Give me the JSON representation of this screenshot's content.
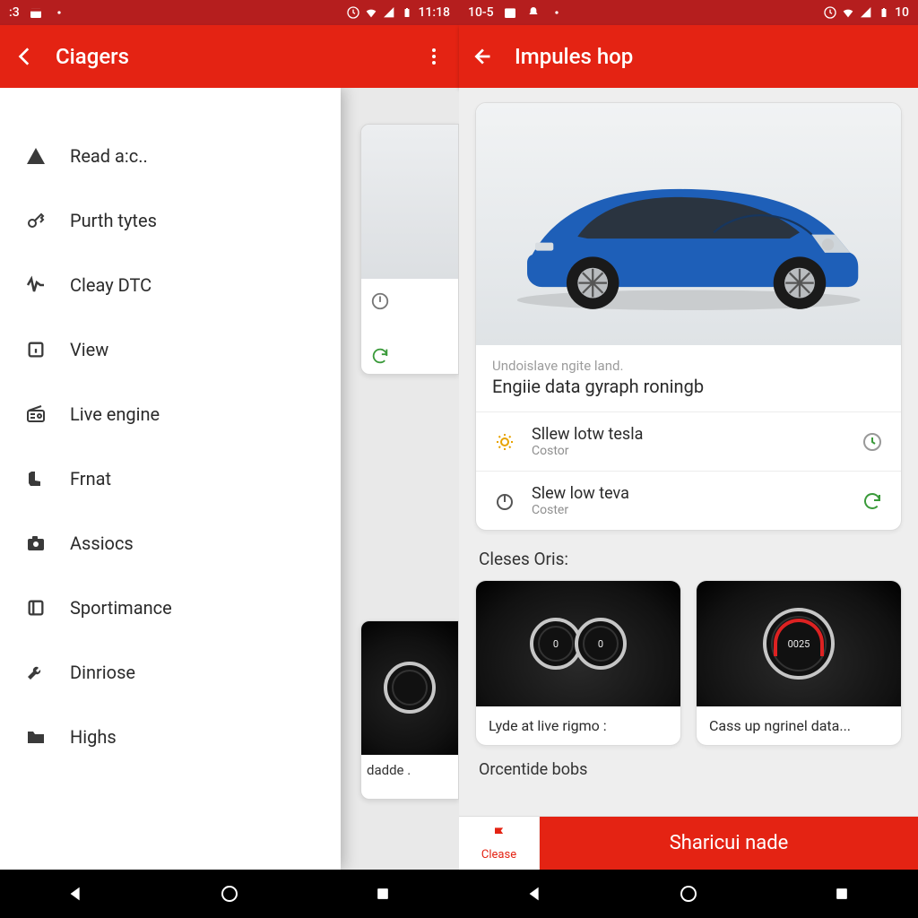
{
  "left": {
    "statusbar": {
      "time_label": ":3",
      "clock": "11:18"
    },
    "appbar": {
      "title": "Ciagers"
    },
    "drawer": {
      "items": [
        {
          "label": "Read a:c.."
        },
        {
          "label": "Purth tytes"
        },
        {
          "label": "Cleay DTC"
        },
        {
          "label": "View"
        },
        {
          "label": "Live engine"
        },
        {
          "label": "Frnat"
        },
        {
          "label": "Assiocs"
        },
        {
          "label": "Sportimance"
        },
        {
          "label": "Dinriose"
        },
        {
          "label": "Highs"
        }
      ]
    },
    "back_peek": {
      "small_label": "dadde ."
    }
  },
  "right": {
    "statusbar": {
      "time_label": "10-5",
      "clock": "10"
    },
    "appbar": {
      "title": "Impules hop"
    },
    "hero": {
      "sub": "Undoislave ngite land.",
      "title": "Engiie data gyraph roningb"
    },
    "rows": [
      {
        "title": "Sllew lotw tesla",
        "sub": "Costor"
      },
      {
        "title": "Slew low teva",
        "sub": "Coster"
      }
    ],
    "section1": "Cleses Oris:",
    "tiles": [
      {
        "label": "Lyde at live rigmo :",
        "num": "00"
      },
      {
        "label": "Cass up ngrinel data...",
        "num": "0025"
      }
    ],
    "section2": "Orcentide bobs",
    "bottom": {
      "tab_label": "Clease",
      "cta": "Sharicui nade"
    }
  },
  "colors": {
    "brand_red": "#e42313",
    "status_red": "#b51e1e"
  }
}
